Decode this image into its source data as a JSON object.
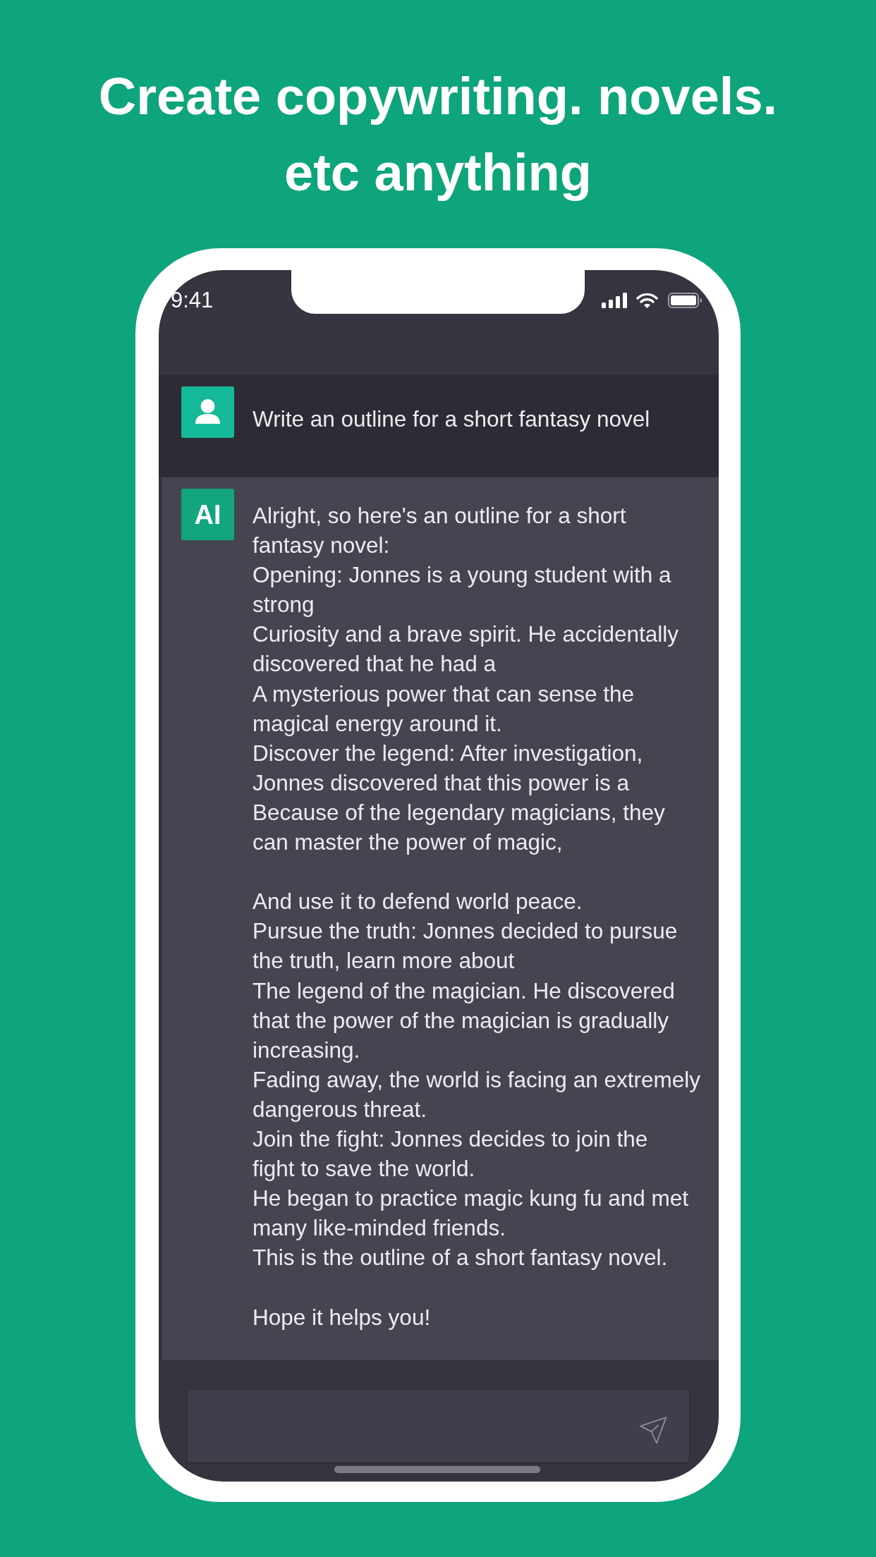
{
  "title": "Create copywriting. novels.\netc anything",
  "status_bar": {
    "time": "9:41"
  },
  "conversation": [
    {
      "kind": "user",
      "paragraphs": [
        [
          "Write an outline for a short fantasy novel"
        ]
      ]
    },
    {
      "kind": "ai",
      "avatar_label": "AI",
      "paragraphs": [
        [
          "Alright, so here's an outline for a short",
          "fantasy novel:",
          "Opening: Jonnes is a young student with a",
          "strong",
          "Curiosity and a brave spirit. He accidentally",
          "discovered that he had a",
          "A mysterious power that can sense the",
          "magical energy around it.",
          "Discover the legend: After investigation,",
          "Jonnes discovered that this power is a",
          "Because of the legendary magicians, they",
          "can master the power of magic,"
        ],
        [
          "And use it to defend world peace.",
          "Pursue the truth: Jonnes decided to pursue",
          "the truth, learn more about",
          "The legend of the magician. He discovered",
          "that the power of the magician is gradually",
          "increasing.",
          "Fading away, the world is facing an extremely",
          "dangerous threat.",
          "Join the fight: Jonnes decides to join the",
          "fight to save the world.",
          "He began to practice magic kung fu and met",
          "many like-minded friends.",
          "This is the outline of a short fantasy novel."
        ],
        [
          "Hope it helps you!"
        ]
      ]
    }
  ]
}
